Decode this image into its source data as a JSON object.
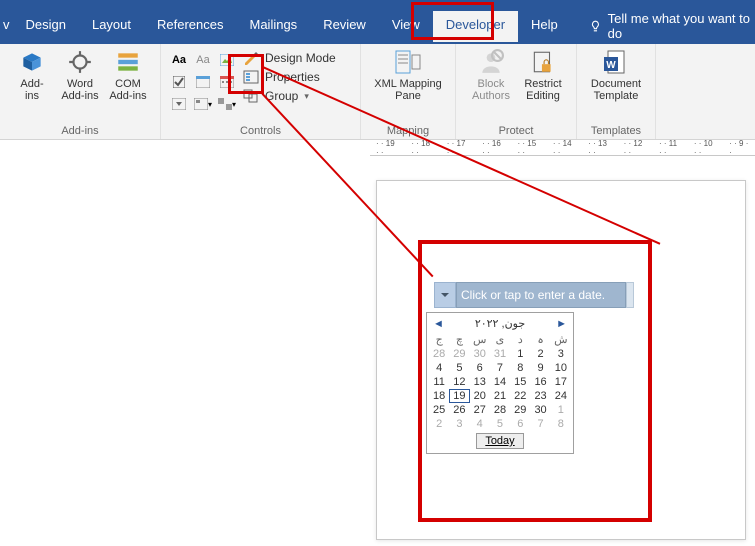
{
  "tabs": {
    "view_partial": "v",
    "design": "Design",
    "layout": "Layout",
    "references": "References",
    "mailings": "Mailings",
    "review": "Review",
    "view": "View",
    "developer": "Developer",
    "help": "Help",
    "tell_me": "Tell me what you want to do"
  },
  "ribbon": {
    "addins": {
      "addins": "Add-\nins",
      "word_addins": "Word\nAdd-ins",
      "com_addins": "COM\nAdd-ins",
      "group": "Add-ins"
    },
    "controls": {
      "design_mode": "Design Mode",
      "properties": "Properties",
      "group": "Group",
      "group_label": "Controls"
    },
    "mapping": {
      "xml_mapping": "XML Mapping\nPane",
      "group": "Mapping"
    },
    "protect": {
      "block_authors": "Block\nAuthors",
      "restrict": "Restrict\nEditing",
      "group": "Protect"
    },
    "templates": {
      "doc_template": "Document\nTemplate",
      "group": "Templates"
    }
  },
  "ruler": [
    "19",
    "18",
    "17",
    "16",
    "15",
    "14",
    "13",
    "12",
    "11",
    "10",
    "9"
  ],
  "datepicker": {
    "placeholder": "Click or tap to enter a date.",
    "month_title": "جون, ۲۰۲۲",
    "day_headers": [
      "ج",
      "چ",
      "س",
      "ی",
      "د",
      "ہ",
      "ش"
    ],
    "weeks": [
      [
        {
          "n": "28",
          "m": true
        },
        {
          "n": "29",
          "m": true
        },
        {
          "n": "30",
          "m": true
        },
        {
          "n": "31",
          "m": true
        },
        {
          "n": "1"
        },
        {
          "n": "2"
        },
        {
          "n": "3"
        }
      ],
      [
        {
          "n": "4"
        },
        {
          "n": "5"
        },
        {
          "n": "6"
        },
        {
          "n": "7"
        },
        {
          "n": "8"
        },
        {
          "n": "9"
        },
        {
          "n": "10"
        }
      ],
      [
        {
          "n": "11"
        },
        {
          "n": "12"
        },
        {
          "n": "13"
        },
        {
          "n": "14"
        },
        {
          "n": "15"
        },
        {
          "n": "16"
        },
        {
          "n": "17"
        }
      ],
      [
        {
          "n": "18"
        },
        {
          "n": "19",
          "sel": true
        },
        {
          "n": "20"
        },
        {
          "n": "21"
        },
        {
          "n": "22"
        },
        {
          "n": "23"
        },
        {
          "n": "24"
        }
      ],
      [
        {
          "n": "25"
        },
        {
          "n": "26"
        },
        {
          "n": "27"
        },
        {
          "n": "28"
        },
        {
          "n": "29"
        },
        {
          "n": "30"
        },
        {
          "n": "1",
          "m": true
        }
      ],
      [
        {
          "n": "2",
          "m": true
        },
        {
          "n": "3",
          "m": true
        },
        {
          "n": "4",
          "m": true
        },
        {
          "n": "5",
          "m": true
        },
        {
          "n": "6",
          "m": true
        },
        {
          "n": "7",
          "m": true
        },
        {
          "n": "8",
          "m": true
        }
      ]
    ],
    "today": "Today"
  }
}
